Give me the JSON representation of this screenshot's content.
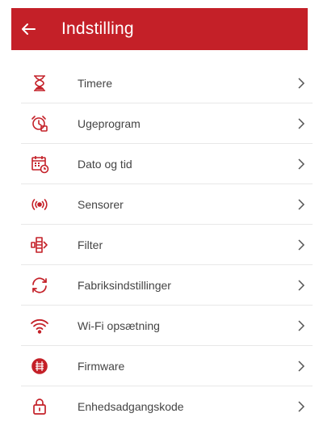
{
  "colors": {
    "accent": "#c42028",
    "text": "#444444",
    "divider": "#e8e8e8"
  },
  "header": {
    "title": "Indstilling",
    "back_icon": "arrow-left-icon"
  },
  "menu": {
    "items": [
      {
        "label": "Timere",
        "icon": "hourglass-icon"
      },
      {
        "label": "Ugeprogram",
        "icon": "weekly-clock-icon"
      },
      {
        "label": "Dato og tid",
        "icon": "calendar-clock-icon"
      },
      {
        "label": "Sensorer",
        "icon": "sensor-icon"
      },
      {
        "label": "Filter",
        "icon": "filter-icon"
      },
      {
        "label": "Fabriksindstillinger",
        "icon": "reset-icon"
      },
      {
        "label": "Wi-Fi opsætning",
        "icon": "wifi-icon"
      },
      {
        "label": "Firmware",
        "icon": "firmware-icon"
      },
      {
        "label": "Enhedsadgangskode",
        "icon": "lock-icon"
      }
    ]
  }
}
